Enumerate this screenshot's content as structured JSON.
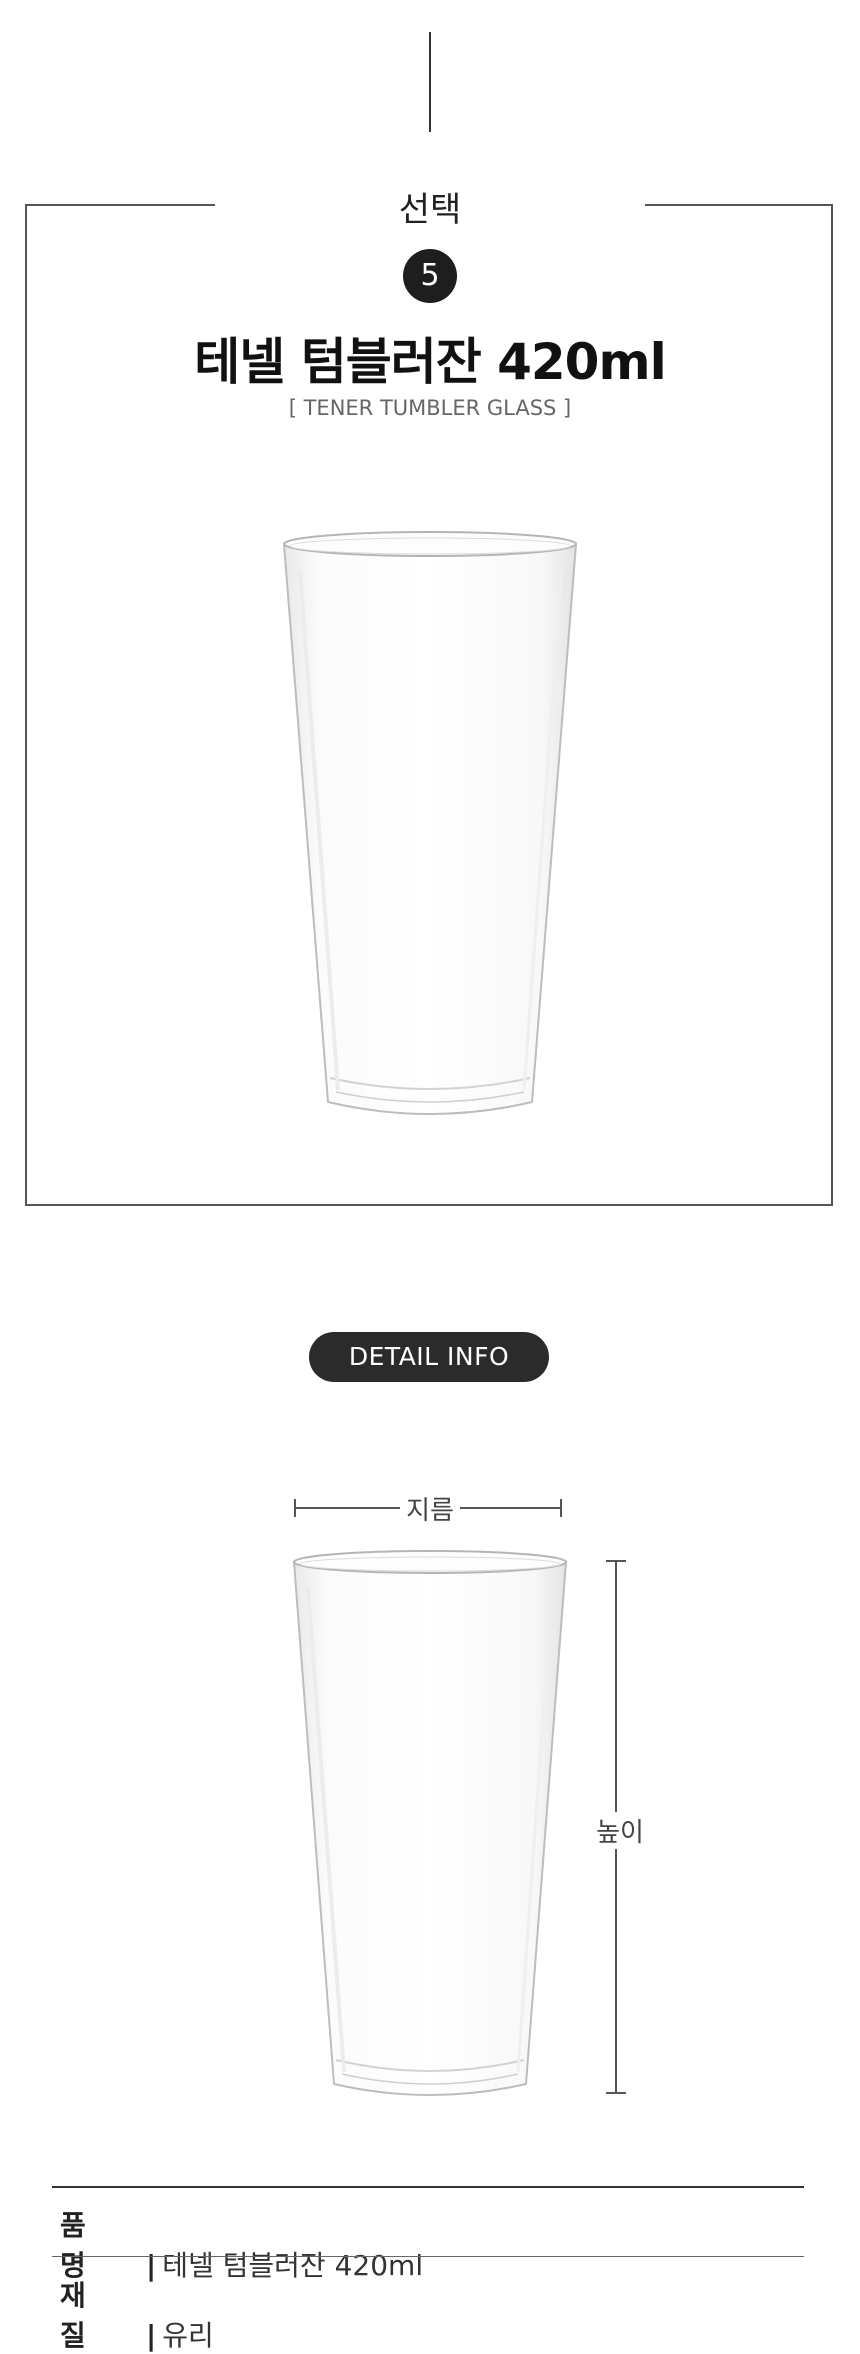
{
  "header": {
    "select_label": "선택",
    "number": "5",
    "title": "테넬 텀블러잔 420ml",
    "subtitle": "[ TENER TUMBLER GLASS ]"
  },
  "detail": {
    "pill_label": "DETAIL INFO",
    "width_label": "지름",
    "height_label": "높이"
  },
  "specs": [
    {
      "key": "품 명",
      "separator": "|",
      "value": "테넬 텀블러잔 420ml"
    },
    {
      "key": "재 질",
      "separator": "|",
      "value": "유리"
    }
  ]
}
